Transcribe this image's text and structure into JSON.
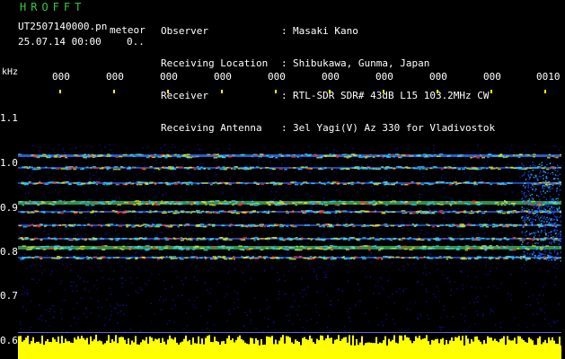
{
  "brand": "HROFFT",
  "file": {
    "name": "UT2507140000.pn",
    "tag": "meteor",
    "timestamp": "25.07.14 00:00",
    "extra": "0.."
  },
  "header": {
    "rows": [
      {
        "label": "Observer",
        "value": "Masaki Kano"
      },
      {
        "label": "Receiving Location",
        "value": "Shibukawa, Gunma, Japan"
      },
      {
        "label": "Receiver",
        "value": "RTL-SDR SDR# 43dB L15 103.2MHz CW"
      },
      {
        "label": "Receiving Antenna",
        "value": "3el Yagi(V) Az 330 for Vladivostok"
      }
    ],
    "colon": ":"
  },
  "axis": {
    "unit": "kHz",
    "y_ticks": [
      "1.1",
      "1.0",
      "0.9",
      "0.8",
      "0.7",
      "0.6"
    ],
    "x_ticks": [
      "000",
      "000",
      "000",
      "000",
      "000",
      "000",
      "000",
      "000",
      "000",
      "0010"
    ]
  },
  "colors": {
    "brand": "#2ecc40",
    "signal_low": "#0000a0",
    "signal_high": "#ff0000",
    "level_bar": "#ffff00",
    "tick_marks": "#ffff00"
  }
}
